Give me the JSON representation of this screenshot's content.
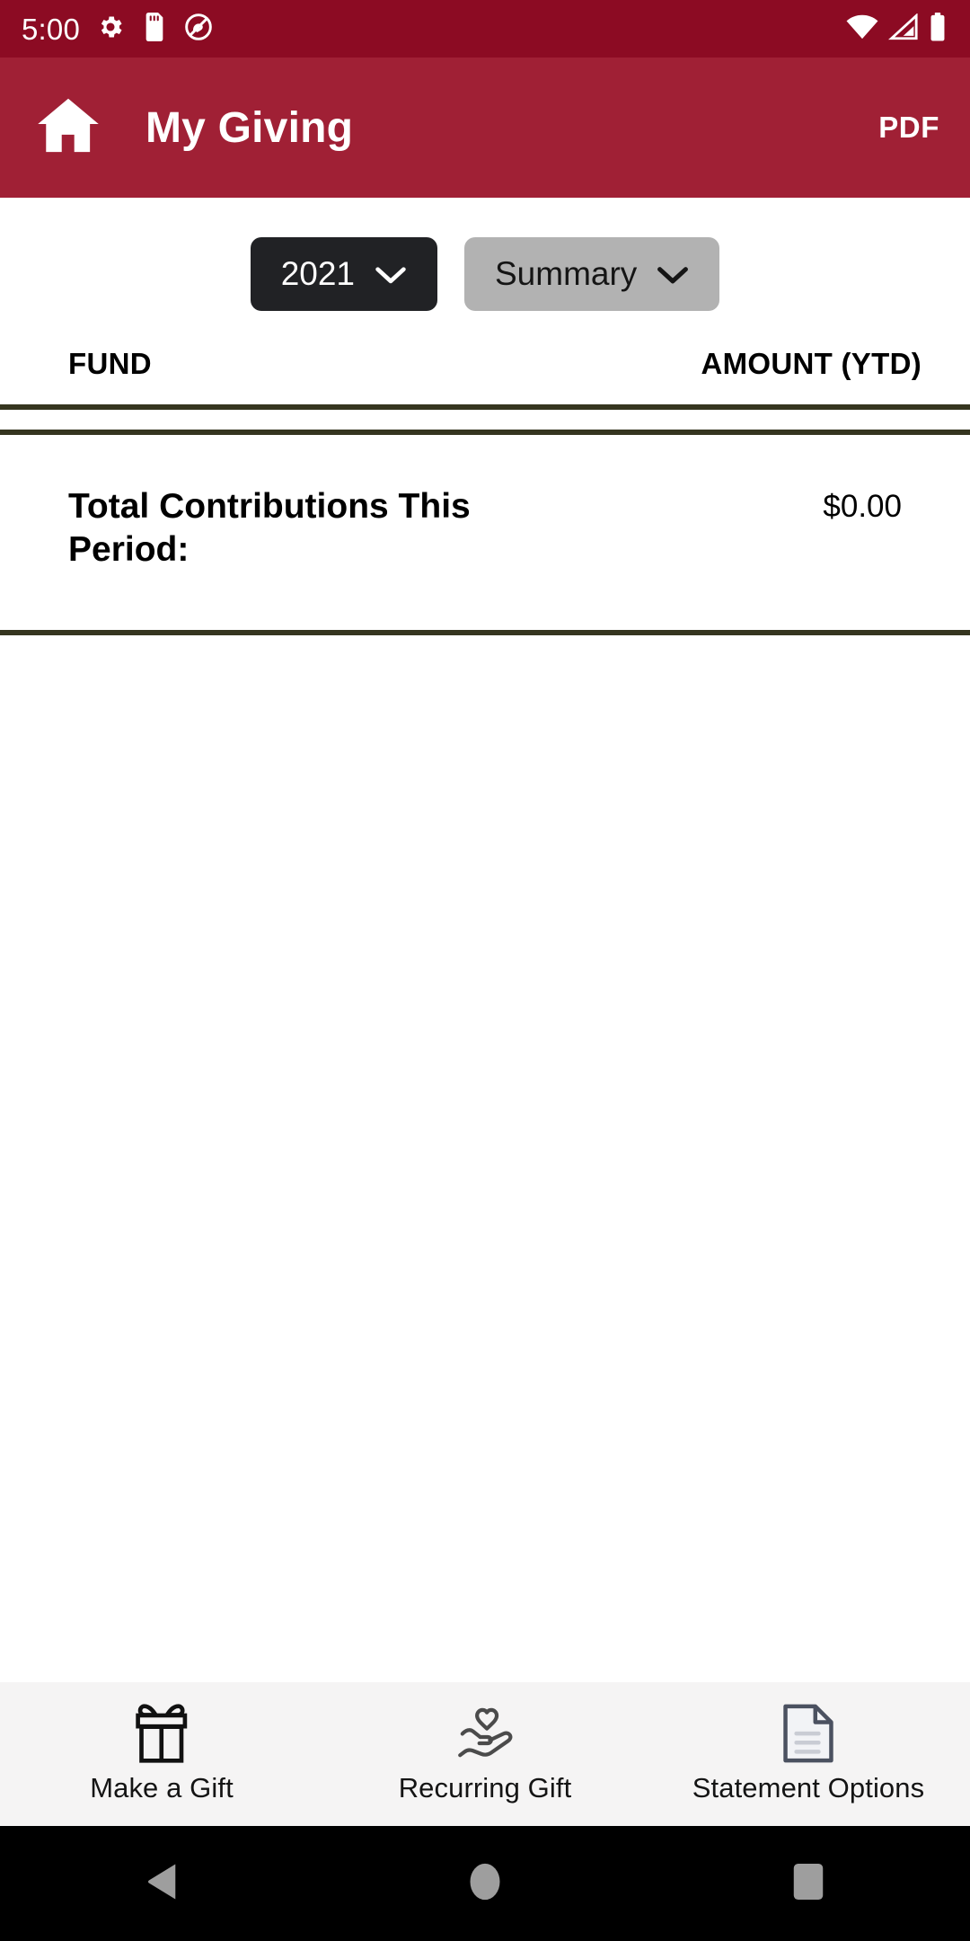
{
  "status_bar": {
    "time": "5:00",
    "icons": [
      "gear-icon",
      "sd-card-icon",
      "do-not-disturb-icon"
    ],
    "right_icons": [
      "wifi-icon",
      "cell-signal-icon",
      "battery-icon"
    ],
    "background": "#8C0B23"
  },
  "app_bar": {
    "home_icon": "home-icon",
    "title": "My Giving",
    "pdf_label": "PDF",
    "background": "#A02035",
    "text_color": "#FFFFFF"
  },
  "filters": {
    "year": {
      "label": "2021",
      "chevron": "chevron-down-icon",
      "background": "#212225",
      "text_color": "#FFFFFF"
    },
    "view": {
      "label": "Summary",
      "chevron": "chevron-down-icon",
      "background": "#B2B2B2",
      "text_color": "#151515"
    }
  },
  "table": {
    "rule_color": "#35351F",
    "columns": [
      "FUND",
      "AMOUNT (YTD)"
    ],
    "rows": [],
    "total": {
      "label": "Total Contributions This Period:",
      "amount": "$0.00"
    }
  },
  "bottom_nav": {
    "items": [
      {
        "label": "Make a Gift",
        "icon": "gift-icon"
      },
      {
        "label": "Recurring Gift",
        "icon": "hand-heart-icon"
      },
      {
        "label": "Statement Options",
        "icon": "document-icon"
      }
    ],
    "background": "#F5F4F4"
  },
  "system_nav": {
    "background": "#000000",
    "buttons": [
      "back-icon",
      "home-circle-icon",
      "recents-square-icon"
    ]
  }
}
